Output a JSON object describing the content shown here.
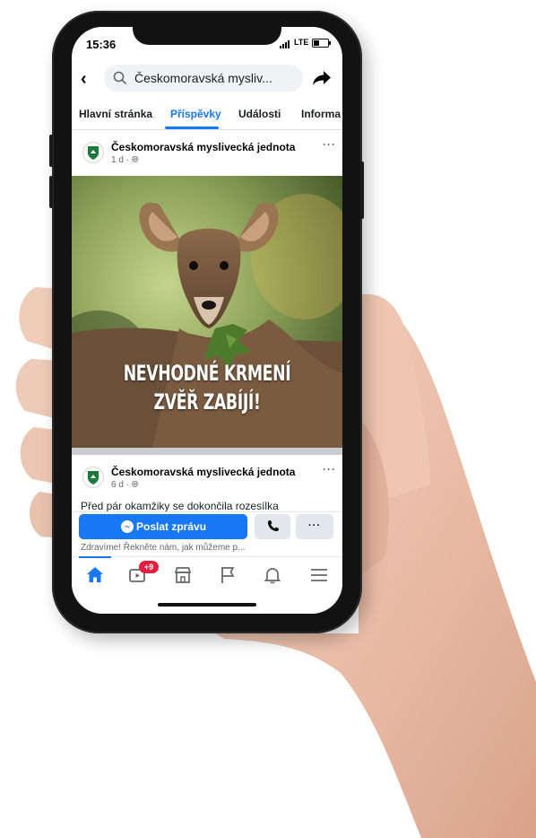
{
  "status": {
    "time": "15:36",
    "network": "LTE"
  },
  "search": {
    "query": "Českomoravská mysliv..."
  },
  "tabs": [
    {
      "label": "Hlavní stránka"
    },
    {
      "label": "Příspěvky"
    },
    {
      "label": "Události"
    },
    {
      "label": "Informa"
    }
  ],
  "active_tab": "Příspěvky",
  "posts": [
    {
      "author": "Českomoravská myslivecká jednota",
      "meta": "1 d · "
    },
    {
      "author": "Českomoravská myslivecká jednota",
      "meta": "6 d · ",
      "text": "Před pár okamžiky se dokončila rozesílka"
    }
  ],
  "photo_headline": {
    "line1": "NEVHODNÉ KRMENÍ",
    "line2": "ZVĚŘ ZABÍJÍ!"
  },
  "actions": {
    "message_label": "Poslat zprávu",
    "more": "···",
    "greeting": "Zdravíme! Řekněte nám, jak můžeme p..."
  },
  "nav": {
    "video_badge": "+9"
  },
  "colors": {
    "accent": "#1877f2",
    "badge": "#e41e3f"
  }
}
